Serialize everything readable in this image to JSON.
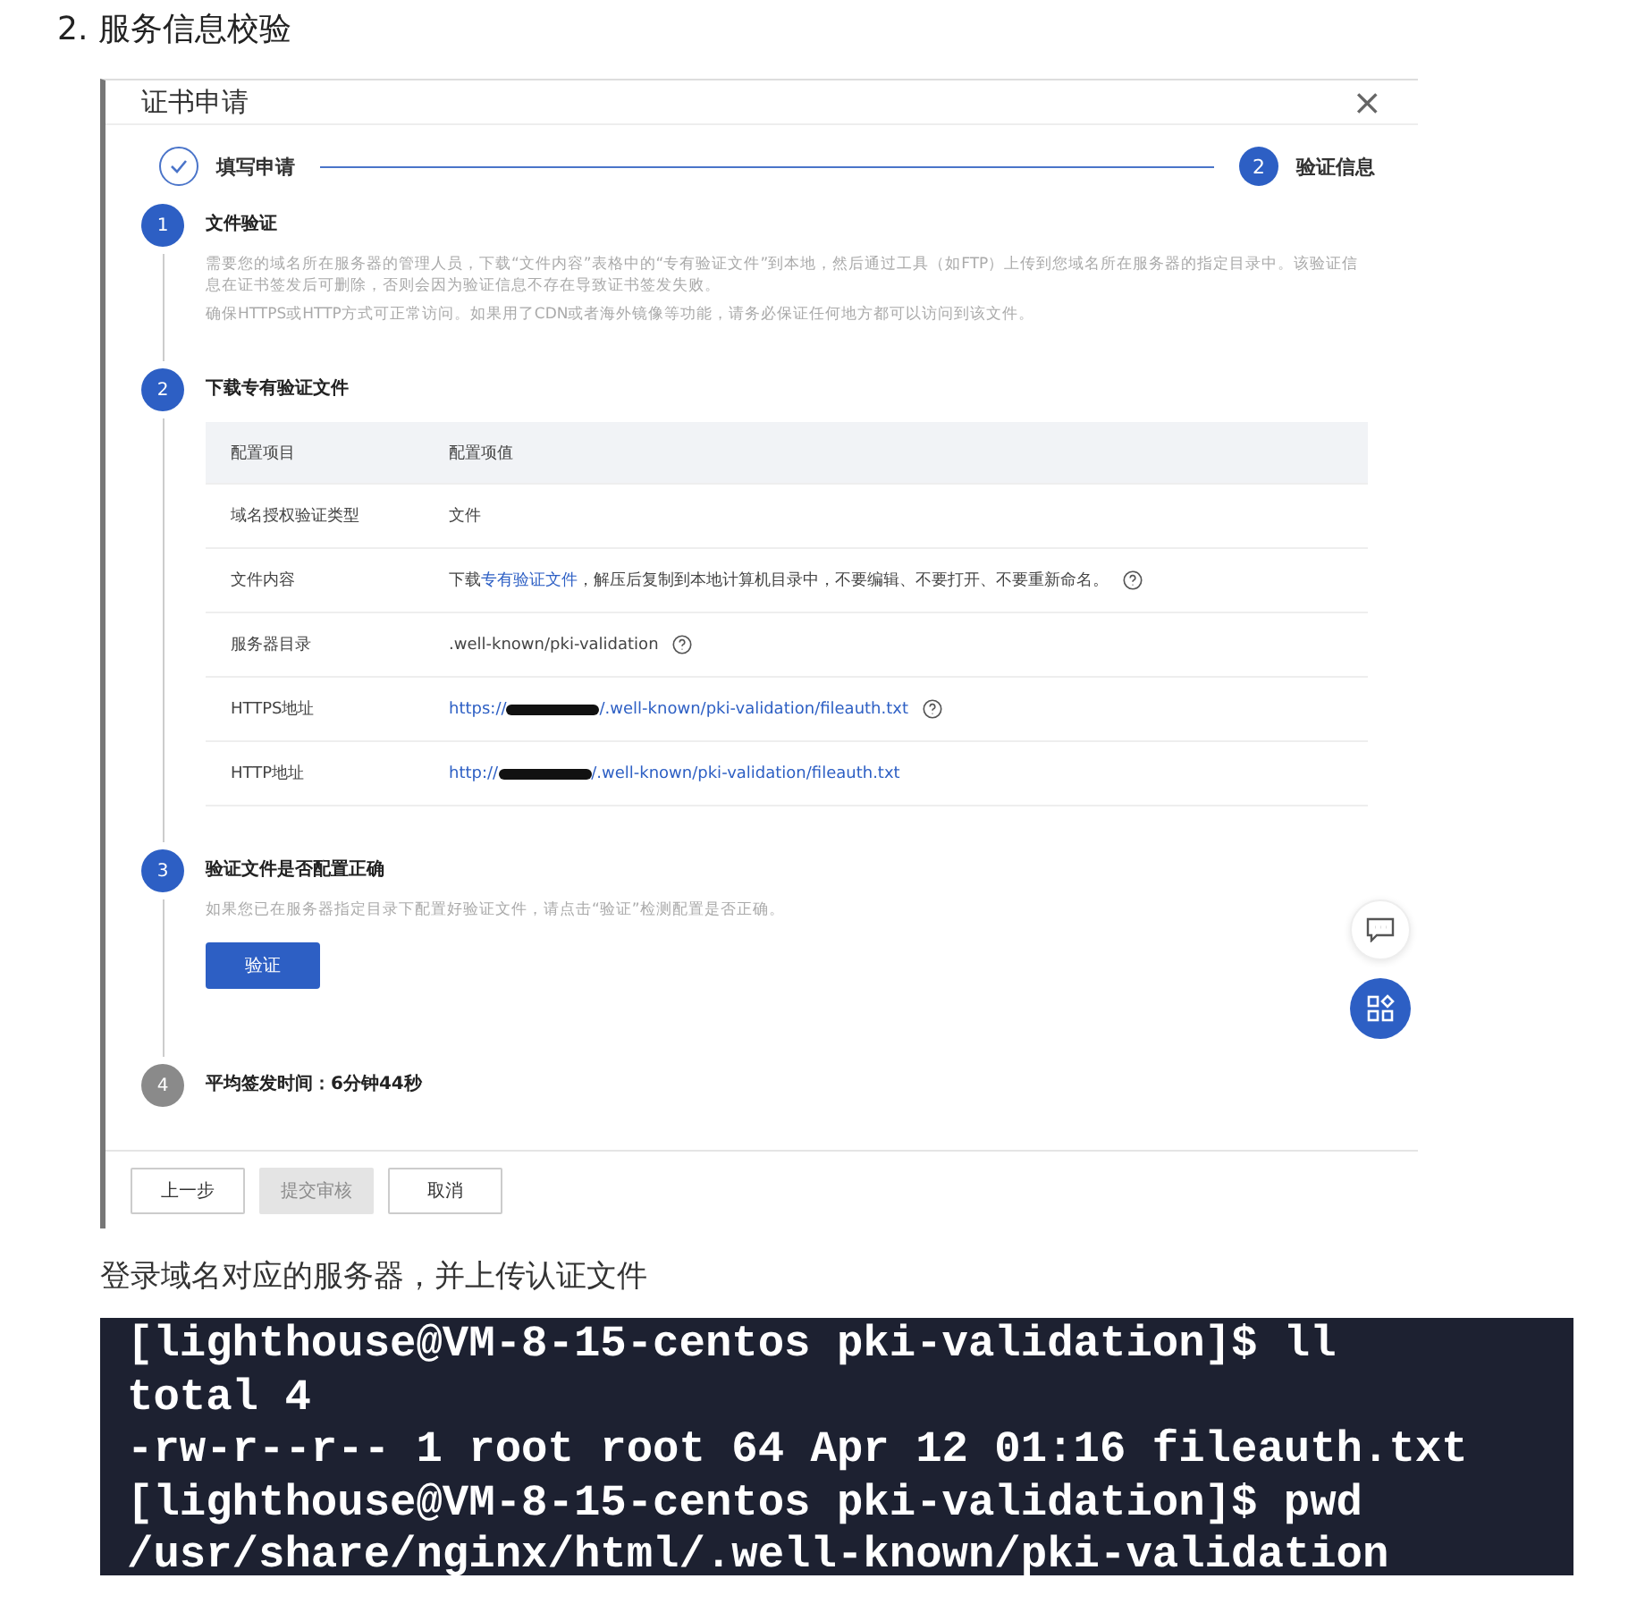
{
  "heading": "2. 服务信息校验",
  "dialog": {
    "title": "证书申请",
    "close": "×",
    "steps": [
      {
        "label": "填写申请",
        "done": true
      },
      {
        "label": "验证信息",
        "done": false,
        "number": "2"
      }
    ],
    "sections": [
      {
        "number": "1",
        "active": true,
        "title": "文件验证",
        "kind": "text",
        "paragraphs": [
          "需要您的域名所在服务器的管理人员，下载“文件内容”表格中的“专有验证文件”到本地，然后通过工具（如FTP）上传到您域名所在服务器的指定目录中。该验证信息在证书签发后可删除，否则会因为验证信息不存在导致证书签发失败。",
          "确保HTTPS或HTTP方式可正常访问。如果用了CDN或者海外镜像等功能，请务必保证任何地方都可以访问到该文件。"
        ]
      },
      {
        "number": "2",
        "active": true,
        "title": "下载专有验证文件",
        "kind": "table",
        "columns": [
          "配置项目",
          "配置项值"
        ],
        "rows": [
          {
            "label": "域名授权验证类型",
            "parts": [
              {
                "kind": "text",
                "text": "文件"
              }
            ],
            "help": false
          },
          {
            "label": "文件内容",
            "parts": [
              {
                "kind": "text",
                "text": "下载 "
              },
              {
                "kind": "link",
                "text": "专有验证文件"
              },
              {
                "kind": "text",
                "text": " ，解压后复制到本地计算机目录中，不要编辑、不要打开、不要重新命名。"
              }
            ],
            "help": true
          },
          {
            "label": "服务器目录",
            "parts": [
              {
                "kind": "text",
                "text": ".well-known/pki-validation"
              }
            ],
            "help": true
          },
          {
            "label": "HTTPS地址",
            "parts": [
              {
                "kind": "link",
                "text": "https://"
              },
              {
                "kind": "redacted"
              },
              {
                "kind": "link",
                "text": "/.well-known/pki-validation/fileauth.txt"
              }
            ],
            "help": true
          },
          {
            "label": "HTTP地址",
            "parts": [
              {
                "kind": "link",
                "text": "http://"
              },
              {
                "kind": "redacted"
              },
              {
                "kind": "link",
                "text": "/.well-known/pki-validation/fileauth.txt"
              }
            ],
            "help": false
          }
        ]
      },
      {
        "number": "3",
        "active": true,
        "title": "验证文件是否配置正确",
        "kind": "verify",
        "paragraphs": [
          "如果您已在服务器指定目录下配置好验证文件，请点击“验证”检测配置是否正确。"
        ],
        "button": "验证"
      },
      {
        "number": "4",
        "active": false,
        "title": "平均签发时间：6分钟44秒",
        "kind": "plain"
      }
    ],
    "footer_buttons": [
      {
        "label": "上一步",
        "disabled": false
      },
      {
        "label": "提交审核",
        "disabled": true
      },
      {
        "label": "取消",
        "disabled": false
      }
    ]
  },
  "caption": "登录域名对应的服务器，并上传认证文件",
  "terminal": [
    "[lighthouse@VM-8-15-centos pki-validation]$ ll",
    "total 4",
    "-rw-r--r-- 1 root root 64 Apr 12 01:16 fileauth.txt",
    "[lighthouse@VM-8-15-centos pki-validation]$ pwd",
    "/usr/share/nginx/html/.well-known/pki-validation"
  ]
}
